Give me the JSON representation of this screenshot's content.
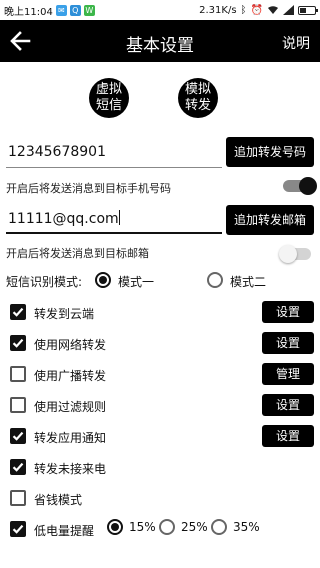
{
  "status_bar": {
    "time": "晚上11:04",
    "speed": "2.31K/s",
    "app_icons": [
      "mail-icon",
      "qq-icon",
      "wechat-icon"
    ]
  },
  "header": {
    "title": "基本设置",
    "help_label": "说明"
  },
  "circles": {
    "virtual_sms": [
      "虚拟",
      "短信"
    ],
    "simulate_forward": [
      "模拟",
      "转发"
    ]
  },
  "phone": {
    "value": "12345678901",
    "add_button": "追加转发号码",
    "toggle_label": "开启后将发送消息到目标手机号码",
    "toggle_on": true
  },
  "email": {
    "value": "11111@qq.com",
    "add_button": "追加转发邮箱",
    "toggle_label": "开启后将发送消息到目标邮箱",
    "toggle_on": false
  },
  "sms_mode": {
    "label": "短信识别模式:",
    "options": [
      "模式一",
      "模式二"
    ],
    "selected": "模式一"
  },
  "options": [
    {
      "label": "转发到云端",
      "checked": true,
      "button": "设置"
    },
    {
      "label": "使用网络转发",
      "checked": true,
      "button": "设置"
    },
    {
      "label": "使用广播转发",
      "checked": false,
      "button": "管理"
    },
    {
      "label": "使用过滤规则",
      "checked": false,
      "button": "设置"
    },
    {
      "label": "转发应用通知",
      "checked": true,
      "button": "设置"
    },
    {
      "label": "转发未接来电",
      "checked": true,
      "button": ""
    },
    {
      "label": "省钱模式",
      "checked": false,
      "button": ""
    },
    {
      "label": "低电量提醒",
      "checked": true,
      "button": ""
    }
  ],
  "battery_levels": {
    "options": [
      "15%",
      "25%",
      "35%"
    ],
    "selected": "15%"
  },
  "colors": {
    "primary": "#000000",
    "background": "#ffffff",
    "toggle_on_track": "#888888",
    "toggle_off_track": "#d4d4d4"
  }
}
